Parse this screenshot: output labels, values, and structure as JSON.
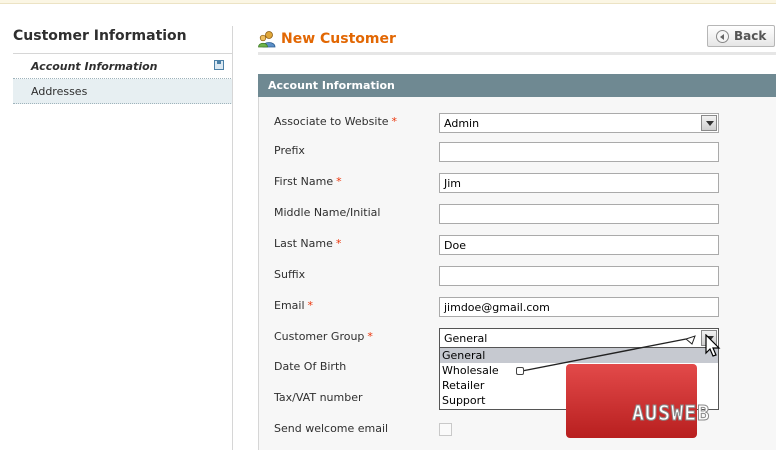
{
  "sidebar": {
    "title": "Customer Information",
    "items": [
      {
        "label": "Account Information"
      },
      {
        "label": "Addresses"
      }
    ]
  },
  "header": {
    "title": "New Customer",
    "back_label": "Back",
    "title_color": "#e26703"
  },
  "section": {
    "title": "Account Information"
  },
  "form": {
    "website": {
      "label": "Associate to Website",
      "value": "Admin"
    },
    "prefix": {
      "label": "Prefix",
      "value": ""
    },
    "first_name": {
      "label": "First Name",
      "value": "Jim"
    },
    "middle_name": {
      "label": "Middle Name/Initial",
      "value": ""
    },
    "last_name": {
      "label": "Last Name",
      "value": "Doe"
    },
    "suffix": {
      "label": "Suffix",
      "value": ""
    },
    "email": {
      "label": "Email",
      "value": "jimdoe@gmail.com"
    },
    "group": {
      "label": "Customer Group",
      "value": "General",
      "options": [
        "General",
        "Wholesale",
        "Retailer",
        "Support"
      ]
    },
    "dob": {
      "label": "Date Of Birth"
    },
    "tax": {
      "label": "Tax/VAT number"
    },
    "welcome": {
      "label": "Send welcome email"
    },
    "required_mark": "*"
  },
  "icons": {
    "save": "save-icon",
    "back": "back-arrow-icon",
    "customer": "customer-icon"
  },
  "watermark": {
    "text": "AUSWEB",
    "color": "#d03030"
  }
}
